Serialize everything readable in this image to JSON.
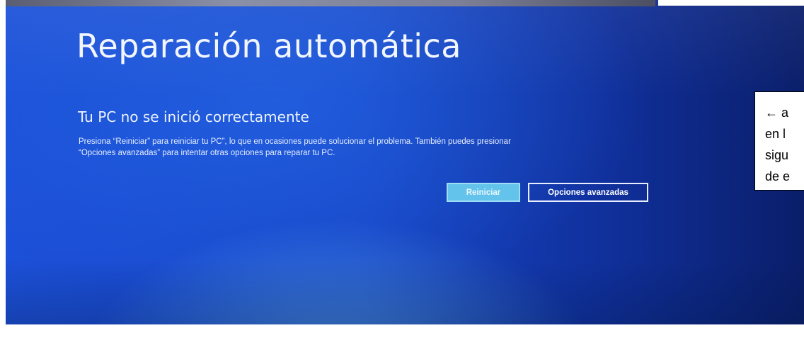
{
  "screen": {
    "title": "Reparación automática",
    "subtitle": "Tu PC no se inició correctamente",
    "message_lines": [
      "Presiona “Reiniciar” para reiniciar tu PC”, lo que en ocasiones puede solucionar el problema. También puedes presionar",
      "“Opciones avanzadas” para intentar otras opciones para reparar tu PC."
    ],
    "buttons": {
      "restart_label": "Reiniciar",
      "advanced_label": "Opciones avanzadas"
    },
    "colors": {
      "background": "#1746c8",
      "restart_button": "#63c3ea",
      "text": "#f2f6ff"
    }
  },
  "annotation": {
    "arrow_icon": "arrow-left-icon",
    "lines": [
      "← a",
      "en l",
      "sigu",
      "de e"
    ]
  }
}
